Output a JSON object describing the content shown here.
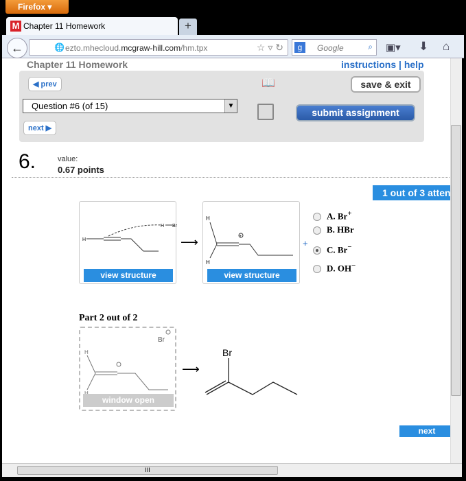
{
  "browser": {
    "menu_label": "Firefox",
    "tab_title": "Chapter 11 Homework",
    "new_tab": "+",
    "url_domain_prefix": "ezto.mhecloud.",
    "url_domain": "mcgraw-hill.com",
    "url_path": "/hm.tpx",
    "search_placeholder": "Google",
    "search_engine": "g"
  },
  "header": {
    "title": "Chapter 11 Homework",
    "links": "instructions | help"
  },
  "toolbar": {
    "prev": "prev",
    "next": "next",
    "save_exit": "save & exit",
    "submit": "submit assignment",
    "question_select": "Question #6 (of 15)"
  },
  "question": {
    "number": "6.",
    "value_label": "value:",
    "points": "0.67 points",
    "attempts": "1 out of 3 atten"
  },
  "part1": {
    "view_structure_1": "view structure",
    "view_structure_2": "view structure",
    "plus": "+",
    "options": [
      {
        "label": "A.",
        "text": "Br",
        "sup": "+"
      },
      {
        "label": "B.",
        "text": "HBr",
        "sup": ""
      },
      {
        "label": "C.",
        "text": "Br",
        "sup": "−"
      },
      {
        "label": "D.",
        "text": "OH",
        "sup": "−"
      }
    ],
    "selected": 2
  },
  "part2": {
    "title": "Part 2 out of 2",
    "window_open": "window open",
    "br_label": "Br",
    "product_br": "Br"
  },
  "bottom": {
    "next": "next"
  },
  "scroll": {
    "grip": "III"
  }
}
